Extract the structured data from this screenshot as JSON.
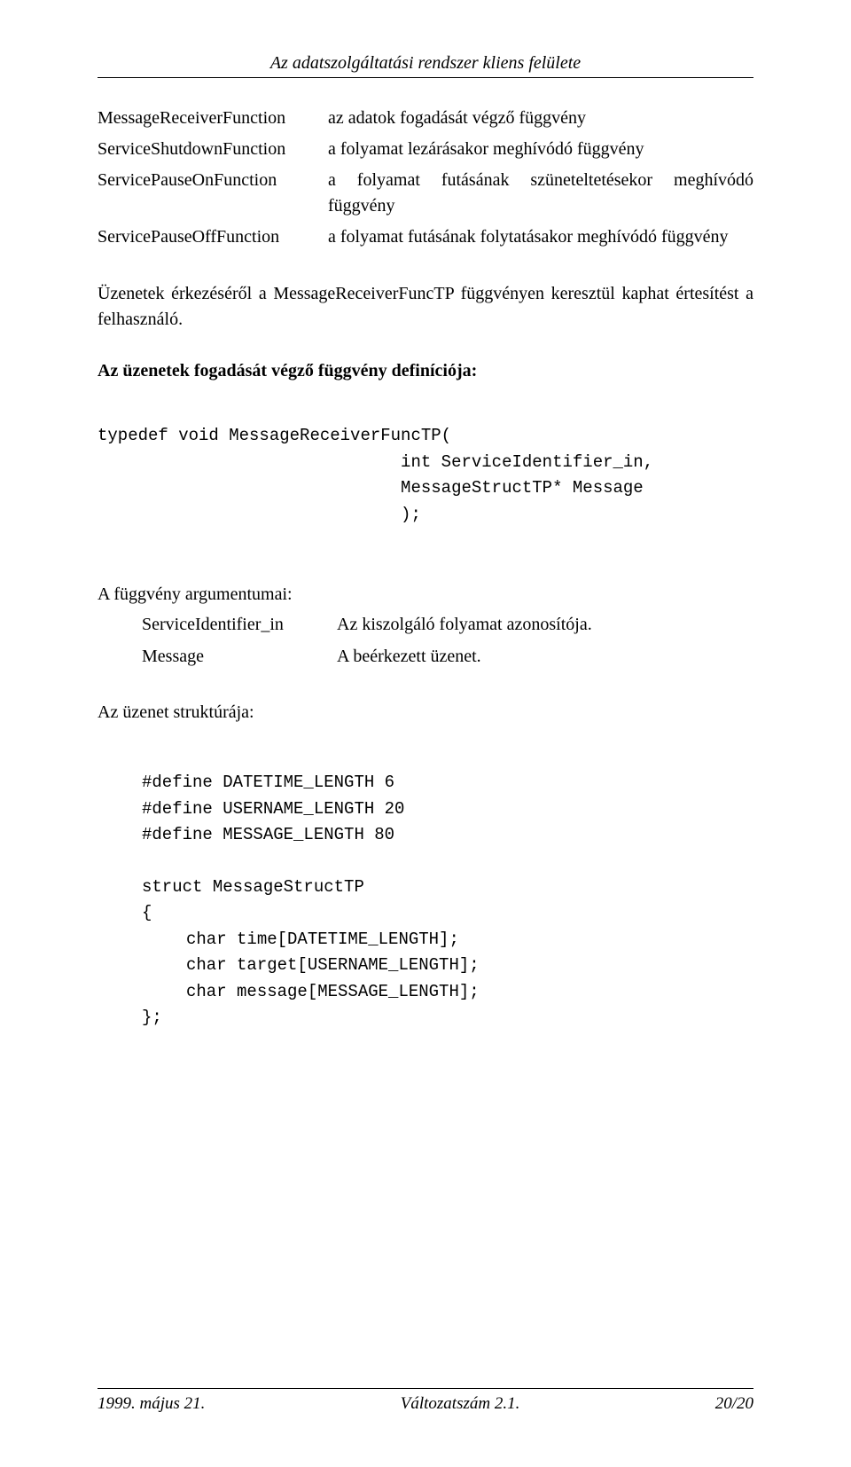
{
  "header": {
    "title": "Az adatszolgáltatási rendszer kliens felülete"
  },
  "defs": [
    {
      "term": "MessageReceiverFunction",
      "desc": "az adatok fogadását végző függvény",
      "inset": ""
    },
    {
      "term": "ServiceShutdownFunction",
      "desc": "a folyamat lezárásakor meghívódó függvény",
      "inset": ""
    },
    {
      "term": "ServicePauseOnFunction",
      "desc": "a folyamat futásának szüneteltetésekor meghívódó függvény",
      "inset": ""
    },
    {
      "term": "ServicePauseOffFunction",
      "desc": "a folyamat futásának folytatásakor meghívódó függvény",
      "inset": ""
    }
  ],
  "para1": "Üzenetek érkezéséről a MessageReceiverFuncTP függvényen keresztül kaphat értesítést a felhasználó.",
  "heading1": "Az üzenetek fogadását végző függvény definíciója:",
  "code1": {
    "l1": "typedef void MessageReceiverFuncTP(",
    "l2": "                              int ServiceIdentifier_in,",
    "l3": "                              MessageStructTP* Message",
    "l4": "                              );"
  },
  "args": {
    "title": "A függvény argumentumai:",
    "rows": [
      {
        "name": "ServiceIdentifier_in",
        "desc": "Az kiszolgáló folyamat azonosítója."
      },
      {
        "name": "Message",
        "desc": "A beérkezett üzenet."
      }
    ]
  },
  "subheading": "Az üzenet struktúrája:",
  "code2": {
    "d1": "#define DATETIME_LENGTH 6",
    "d2": "#define USERNAME_LENGTH 20",
    "d3": "#define MESSAGE_LENGTH 80",
    "s1": "struct MessageStructTP",
    "s2": "{",
    "m1": "char time[DATETIME_LENGTH];",
    "m2": "char target[USERNAME_LENGTH];",
    "m3": "char message[MESSAGE_LENGTH];",
    "s3": "};"
  },
  "footer": {
    "left": "1999. május 21.",
    "center": "Változatszám 2.1.",
    "right": "20/20"
  }
}
